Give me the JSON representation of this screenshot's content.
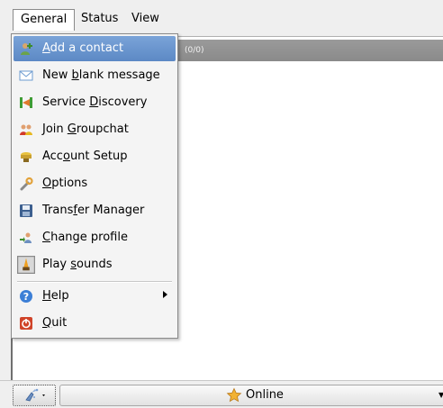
{
  "menubar": {
    "items": [
      {
        "label": "General",
        "active": true
      },
      {
        "label": "Status",
        "active": false
      },
      {
        "label": "View",
        "active": false
      }
    ]
  },
  "roster": {
    "count": "(0/0)"
  },
  "menu": {
    "items": [
      {
        "pre": "",
        "mn": "A",
        "post": "dd a contact",
        "icon": "add-contact-icon",
        "highlight": true
      },
      {
        "pre": "New ",
        "mn": "b",
        "post": "lank message",
        "icon": "envelope-icon"
      },
      {
        "pre": "Service ",
        "mn": "D",
        "post": "iscovery",
        "icon": "service-discovery-icon"
      },
      {
        "pre": "Join ",
        "mn": "G",
        "post": "roupchat",
        "icon": "groupchat-icon"
      },
      {
        "pre": "Acc",
        "mn": "o",
        "post": "unt Setup",
        "icon": "account-setup-icon"
      },
      {
        "pre": "",
        "mn": "O",
        "post": "ptions",
        "icon": "options-wrench-icon"
      },
      {
        "pre": "Trans",
        "mn": "f",
        "post": "er Manager",
        "icon": "transfer-manager-icon"
      },
      {
        "pre": "",
        "mn": "C",
        "post": "hange profile",
        "icon": "change-profile-icon"
      },
      {
        "pre": "Play ",
        "mn": "s",
        "post": "ounds",
        "icon": "sound-toggle-icon"
      },
      {
        "pre": "",
        "mn": "H",
        "post": "elp",
        "icon": "help-icon",
        "submenu": true
      },
      {
        "pre": "",
        "mn": "Q",
        "post": "uit",
        "icon": "quit-icon"
      }
    ]
  },
  "statusbar": {
    "status": "Online",
    "status_icon": "star-online-icon",
    "presence_icon": "sparkle-menu-icon"
  },
  "colors": {
    "highlight": "#6a94cc",
    "roster_header": "#909090",
    "background": "#efefef"
  }
}
